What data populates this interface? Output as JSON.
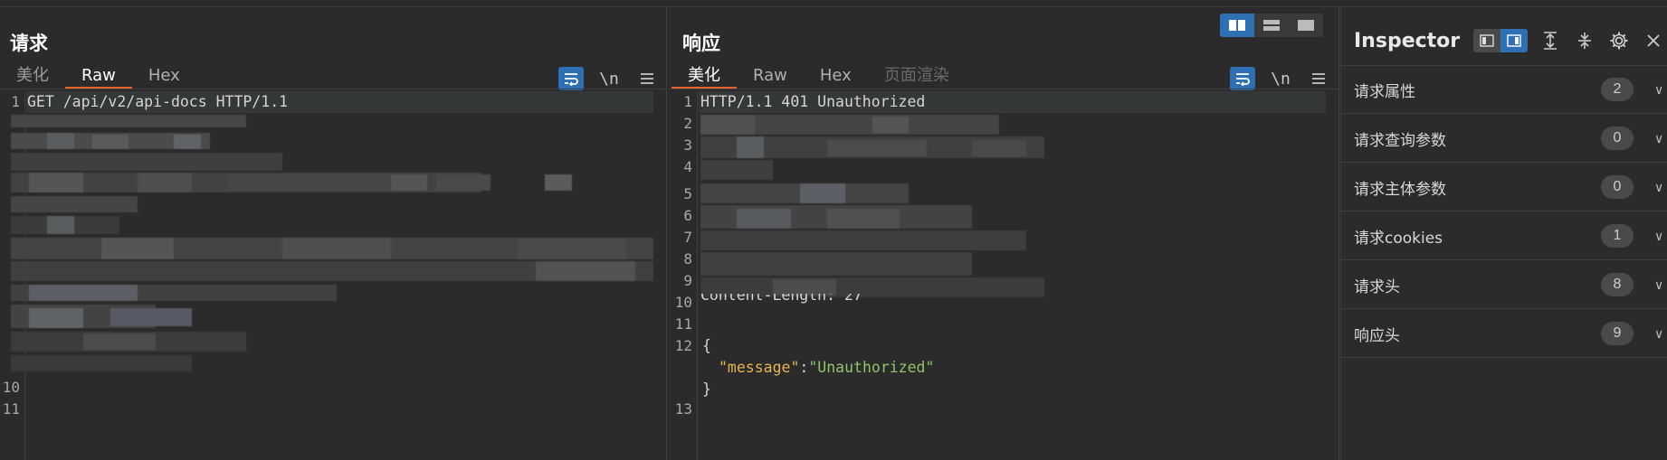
{
  "request": {
    "title": "请求",
    "tabs": [
      "美化",
      "Raw",
      "Hex"
    ],
    "active_tab": "Raw",
    "lines": [
      {
        "no": "1",
        "text": "GET /api/v2/api-docs HTTP/1.1"
      },
      {
        "no": "10",
        "text": ""
      },
      {
        "no": "11",
        "text": ""
      }
    ]
  },
  "response": {
    "title": "响应",
    "tabs": [
      "美化",
      "Raw",
      "Hex",
      "页面渲染"
    ],
    "active_tab": "美化",
    "line_numbers": [
      "1",
      "2",
      "3",
      "4",
      "5",
      "6",
      "7",
      "8",
      "9",
      "10",
      "11",
      "12",
      "13"
    ],
    "status_line": "HTTP/1.1 401 Unauthorized",
    "partial_line": "Content-Length: 27",
    "json_open": "{",
    "json_key": "\"message\"",
    "json_colon": ":",
    "json_value": "\"Unauthorized\"",
    "json_close": "}"
  },
  "toolbar": {
    "wrap_icon": "wrap-lines-icon",
    "newline_label": "\\n",
    "menu_icon": "hamburger-menu-icon"
  },
  "inspector": {
    "title": "Inspector",
    "rows": [
      {
        "label": "请求属性",
        "count": "2"
      },
      {
        "label": "请求查询参数",
        "count": "0"
      },
      {
        "label": "请求主体参数",
        "count": "0"
      },
      {
        "label": "请求cookies",
        "count": "1"
      },
      {
        "label": "请求头",
        "count": "8"
      },
      {
        "label": "响应头",
        "count": "9"
      }
    ]
  },
  "colors": {
    "accent": "#2f6fb3",
    "active_tab_underline": "#e5632d",
    "json_key": "#e6b450",
    "json_string": "#8fc46a"
  }
}
